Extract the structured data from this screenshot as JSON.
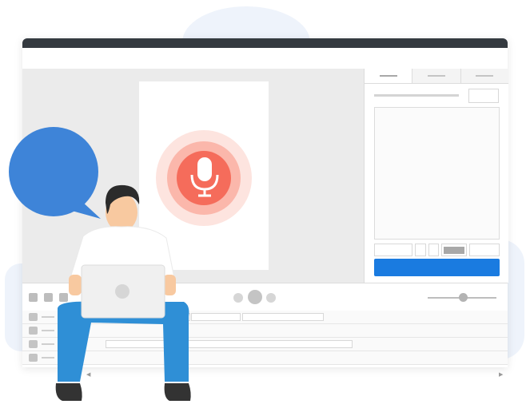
{
  "illustration": {
    "type": "voice-recording-editor",
    "colors": {
      "accent": "#1a7be0",
      "speech_bubble": "#3e84d8",
      "mic_core": "#f56c5b",
      "mic_ring_mid": "#fbb7ab",
      "mic_ring_outer": "#fde4df",
      "titlebar": "#343a40",
      "shirt": "#ffffff",
      "pants": "#2f8fd6",
      "hair": "#2b2b2b",
      "skin": "#f8c9a0",
      "shoes": "#333333"
    },
    "icons": {
      "microphone": "microphone-icon",
      "speech_bubble": "speech-bubble-icon",
      "laptop": "laptop-icon",
      "person": "person-at-laptop"
    }
  },
  "window": {
    "right_panel": {
      "tabs": [
        "",
        "",
        ""
      ],
      "active_tab": 0
    },
    "transport": {
      "play_control": "play-button",
      "volume_slider_level": 0.51
    }
  }
}
